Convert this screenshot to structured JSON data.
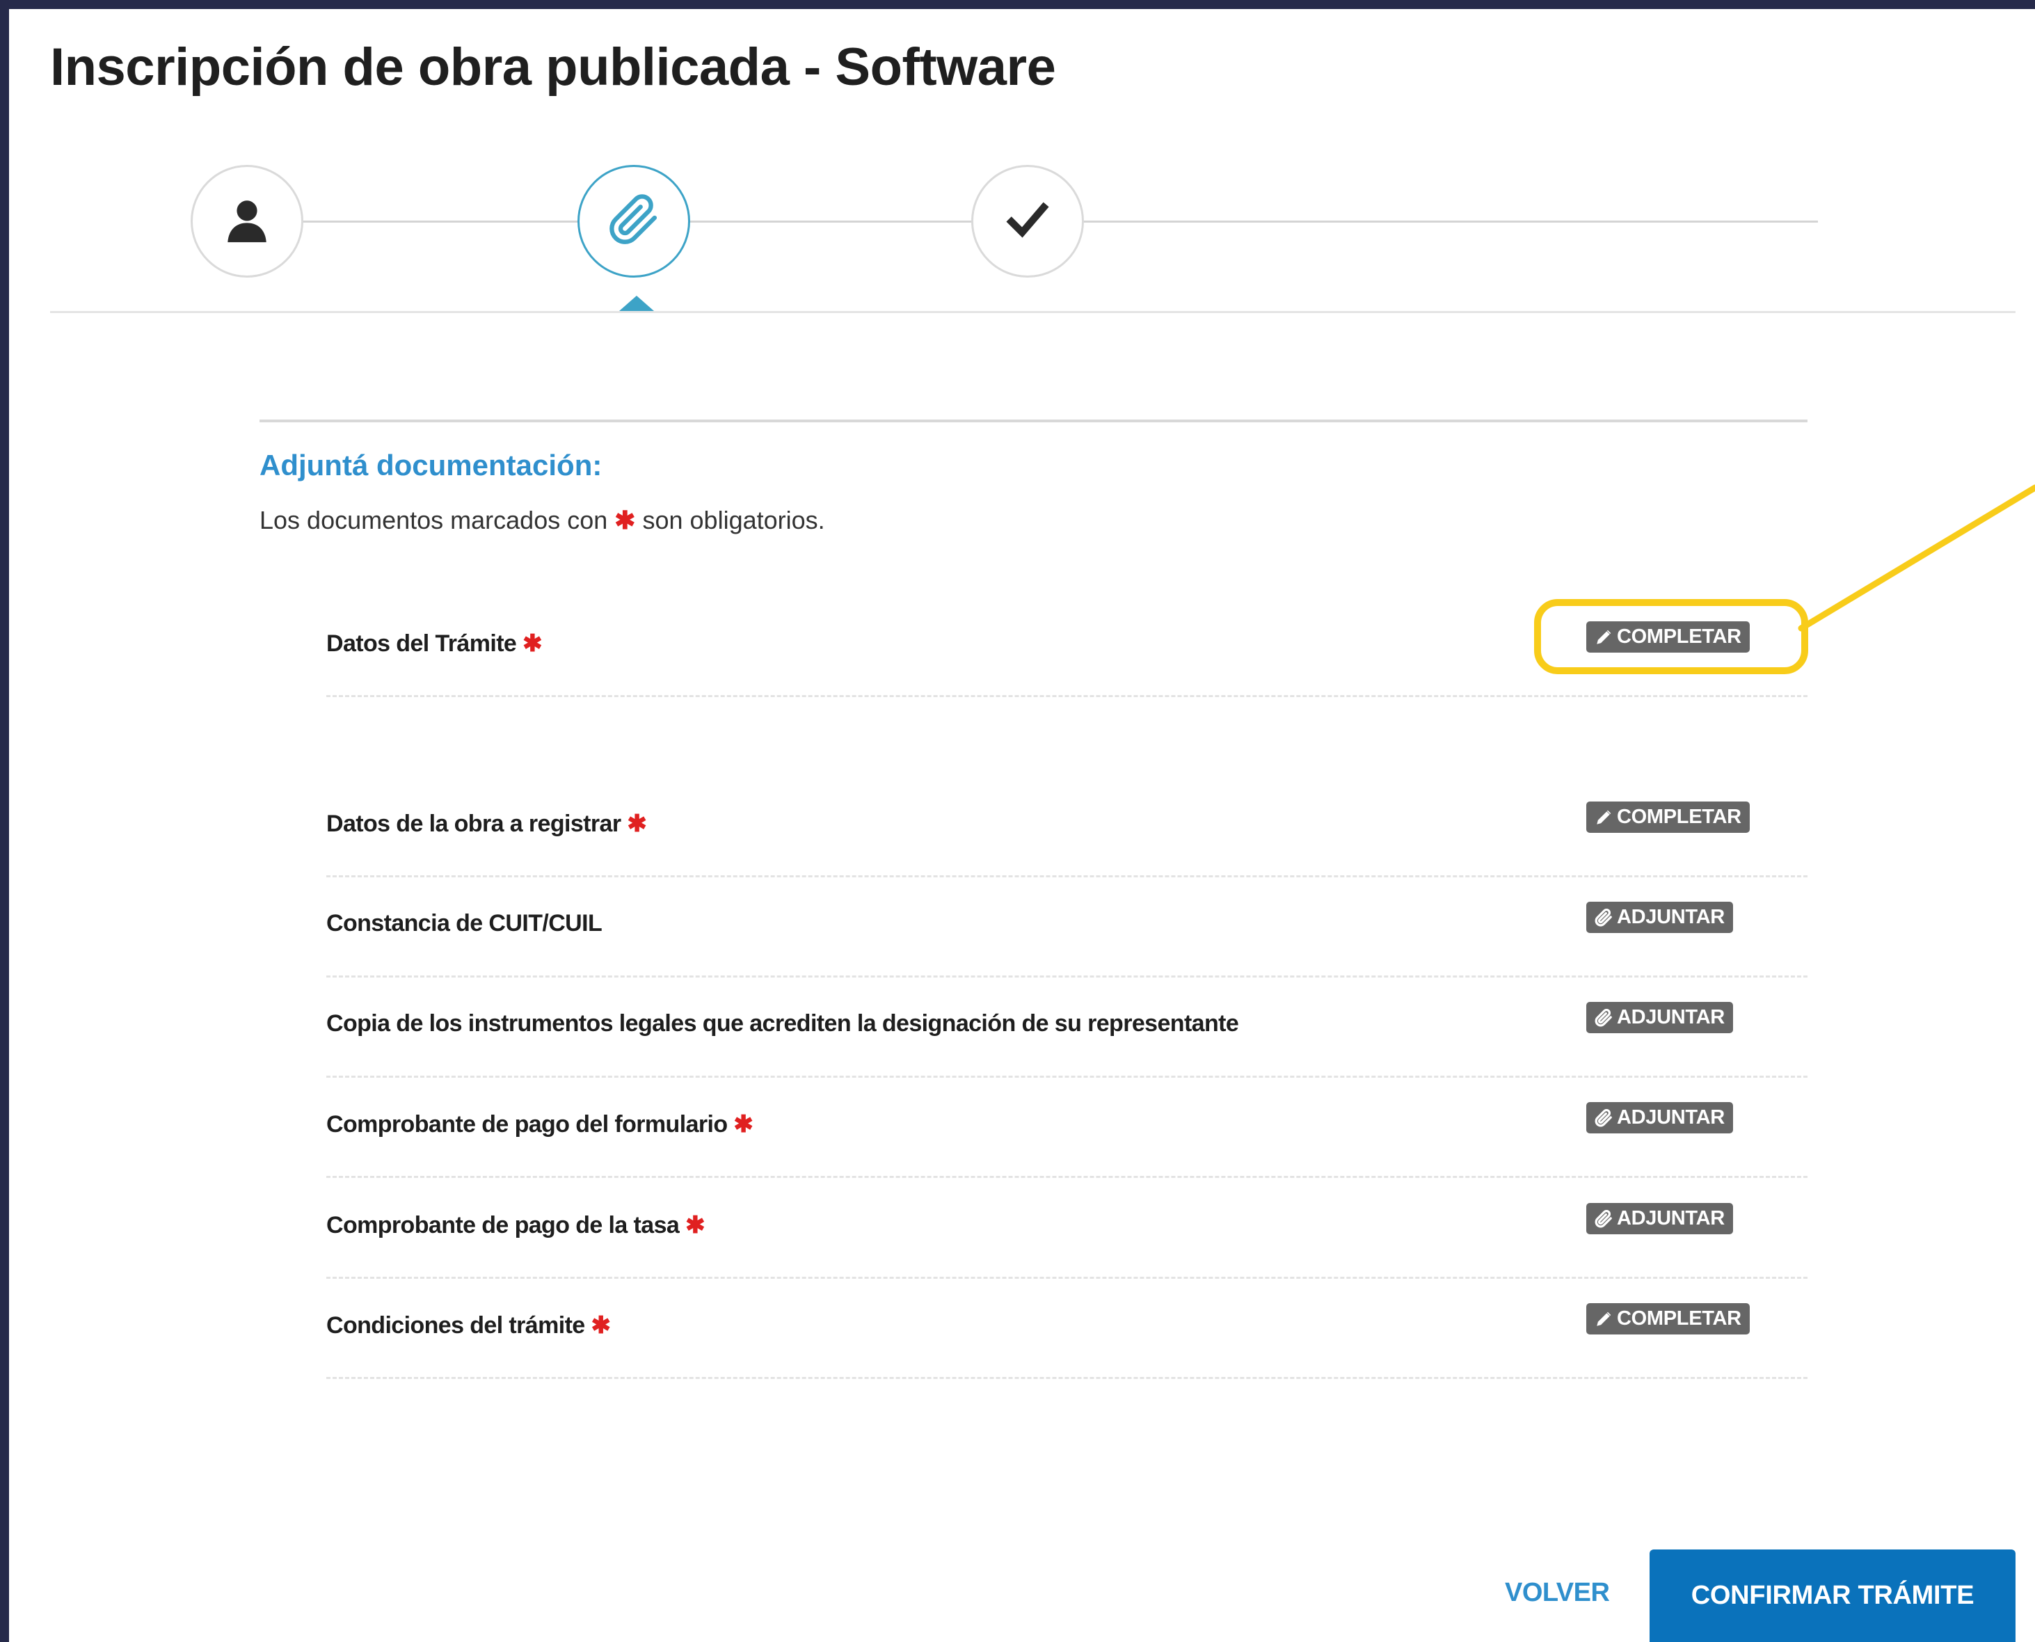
{
  "page": {
    "title": "Inscripción de obra publicada - Software"
  },
  "stepper": {
    "steps": [
      {
        "icon": "user-icon",
        "state": "done"
      },
      {
        "icon": "paperclip-icon",
        "state": "active"
      },
      {
        "icon": "checkmark-icon",
        "state": "pending"
      }
    ]
  },
  "section": {
    "title": "Adjuntá documentación:",
    "subtitle_before": "Los documentos marcados con",
    "subtitle_star": "✱",
    "subtitle_after": "son obligatorios."
  },
  "documents": [
    {
      "label": "Datos del Trámite",
      "required": "✱",
      "action": "COMPLETAR",
      "action_icon": "pencil-icon"
    },
    {
      "label": "Datos de la obra a registrar",
      "required": "✱",
      "action": "COMPLETAR",
      "action_icon": "pencil-icon"
    },
    {
      "label": "Constancia de CUIT/CUIL",
      "required": "",
      "action": "ADJUNTAR",
      "action_icon": "paperclip-icon"
    },
    {
      "label": "Copia de los instrumentos legales que acrediten la designación de su representante",
      "required": "",
      "action": "ADJUNTAR",
      "action_icon": "paperclip-icon"
    },
    {
      "label": "Comprobante de pago del formulario",
      "required": "✱",
      "action": "ADJUNTAR",
      "action_icon": "paperclip-icon"
    },
    {
      "label": "Comprobante de pago de la tasa",
      "required": "✱",
      "action": "ADJUNTAR",
      "action_icon": "paperclip-icon"
    },
    {
      "label": "Condiciones del trámite",
      "required": "✱",
      "action": "COMPLETAR",
      "action_icon": "pencil-icon"
    }
  ],
  "footer": {
    "back_label": "VOLVER",
    "confirm_label": "CONFIRMAR TRÁMITE"
  },
  "colors": {
    "frame_border": "#262a4a",
    "accent_blue": "#2f8fcd",
    "primary_button": "#0a72bb",
    "required_star": "#e02020",
    "action_button": "#666666",
    "highlight": "#f8cc1a"
  }
}
